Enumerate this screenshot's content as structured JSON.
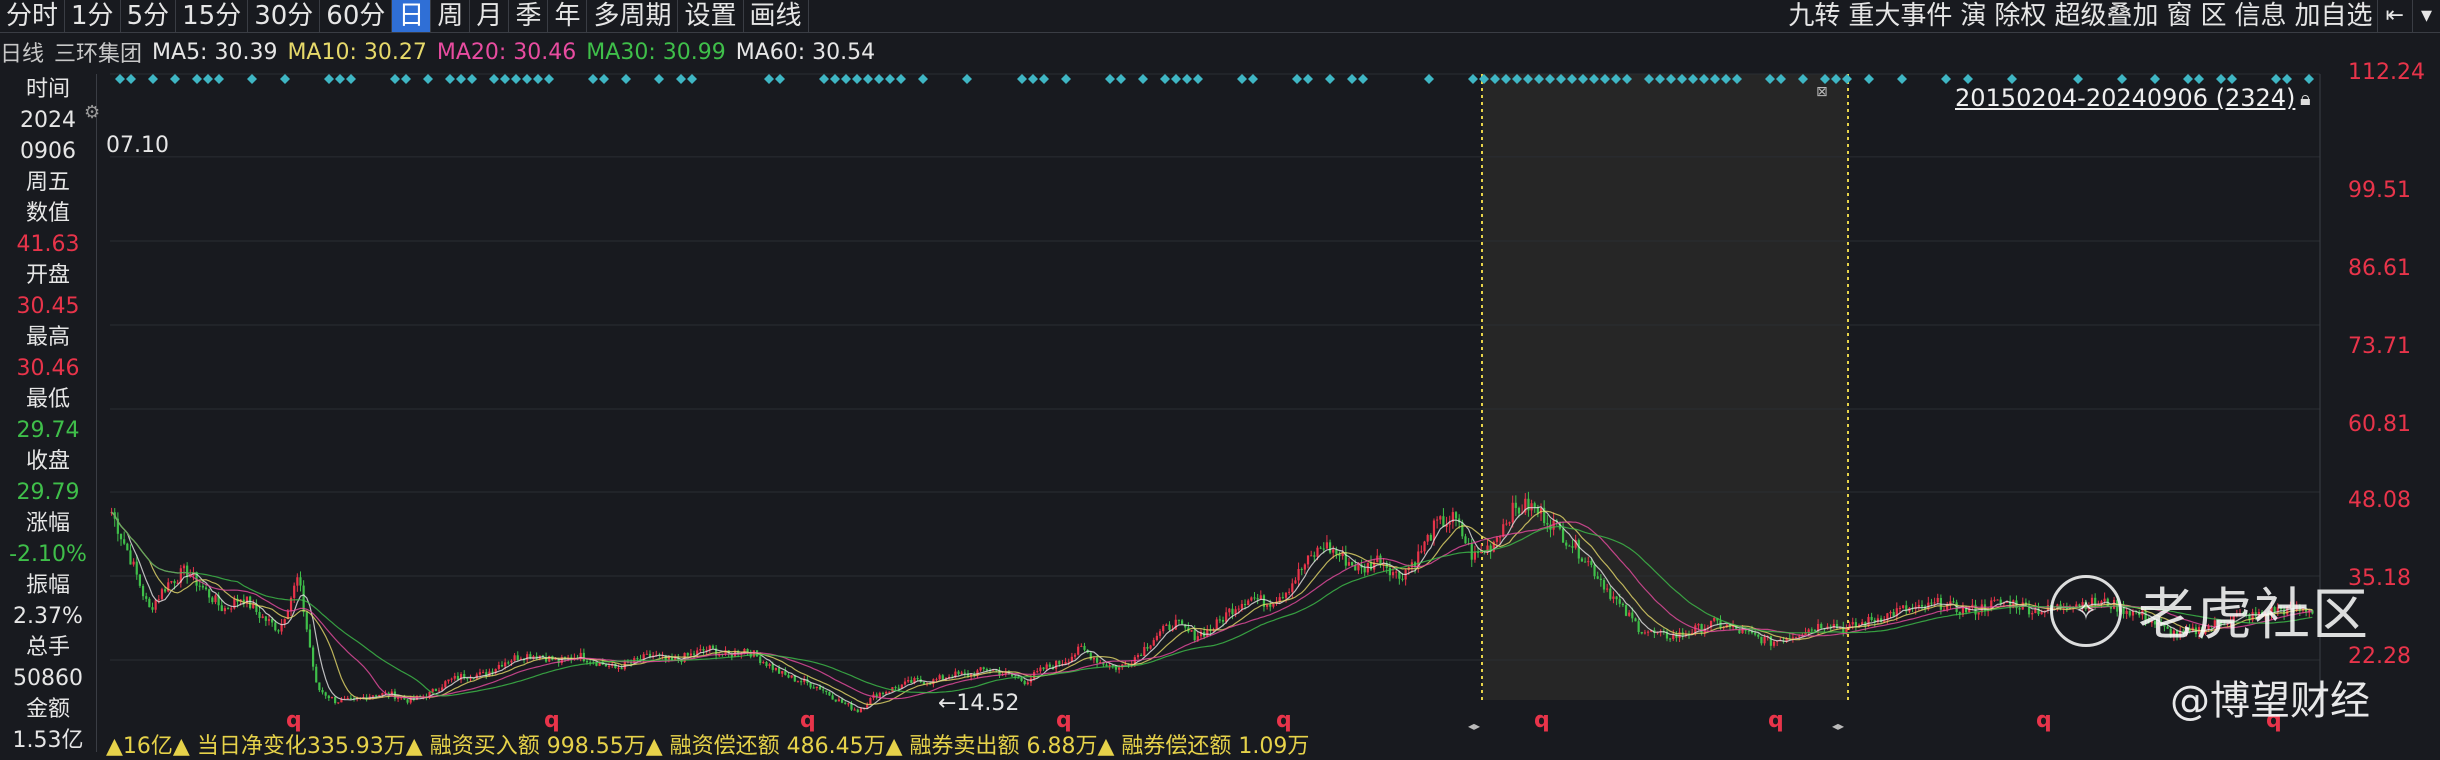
{
  "toolbar": {
    "periods": [
      "分时",
      "1分",
      "5分",
      "15分",
      "30分",
      "60分",
      "日",
      "周",
      "月",
      "季",
      "年",
      "多周期",
      "设置",
      "画线"
    ],
    "active_period": "日",
    "right_items": [
      "九转",
      "重大事件",
      "演",
      "除权",
      "超级叠加",
      "窗",
      "区",
      "信息",
      "加自选"
    ],
    "icons": [
      "jump-to-start-icon",
      "dropdown-arrow-icon"
    ]
  },
  "ma_bar": {
    "chart_type": "日线",
    "stock_name": "三环集团",
    "ma5": "MA5: 30.39",
    "ma10": "MA10: 30.27",
    "ma20": "MA20: 30.46",
    "ma30": "MA30: 30.99",
    "ma60": "MA60: 30.54",
    "colors": {
      "ma5": "#e6e6e6",
      "ma10": "#e6d96a",
      "ma20": "#e84ca0",
      "ma30": "#3fbf4a",
      "ma60": "#e6e6e6"
    }
  },
  "sidebar": [
    {
      "label": "时间",
      "value": "2024",
      "value2": "0906",
      "value3": "周五"
    },
    {
      "label": "数值",
      "value": "41.63",
      "color": "#e8344a"
    },
    {
      "label": "开盘",
      "value": "30.45",
      "color": "#e8344a"
    },
    {
      "label": "最高",
      "value": "30.46",
      "color": "#e8344a"
    },
    {
      "label": "最低",
      "value": "29.74",
      "color": "#3fbf4a"
    },
    {
      "label": "收盘",
      "value": "29.79",
      "color": "#3fbf4a"
    },
    {
      "label": "涨幅",
      "value": "-2.10%",
      "color": "#3fbf4a"
    },
    {
      "label": "振幅",
      "value": "2.37%",
      "color": "#e6e6e6"
    },
    {
      "label": "总手",
      "value": "50860",
      "color": "#e6e6e6"
    },
    {
      "label": "金额",
      "value": "1.53亿",
      "color": "#e6e6e6"
    }
  ],
  "chart": {
    "range_label": "20150204-20240906 (2324)",
    "price_axis": [
      "112.24",
      "99.51",
      "86.61",
      "73.71",
      "60.81",
      "48.08",
      "35.18",
      "22.28"
    ],
    "cursor_price_left": "07.10",
    "min_marker": "14.52",
    "q_marker": "q",
    "colors": {
      "up": "#e8344a",
      "down": "#3fbf4a",
      "diamond": "#3fb6c4",
      "highlight": "#262626",
      "vline": "#e6d24a"
    }
  },
  "chart_data": {
    "type": "candlestick",
    "x_range": [
      "20150204",
      "20240906"
    ],
    "bar_count": 2324,
    "ylim": [
      14.52,
      112.24
    ],
    "y_ticks": [
      112.24,
      99.51,
      86.61,
      73.71,
      60.81,
      48.08,
      35.18,
      22.28
    ],
    "close_trend": [
      45,
      38,
      30,
      34,
      36,
      33,
      30,
      32,
      29,
      27,
      35,
      18,
      16,
      16,
      17,
      17,
      16,
      17,
      19,
      20,
      20,
      22,
      23,
      23,
      22,
      23,
      22,
      21,
      22,
      23,
      22,
      23,
      24,
      23,
      24,
      22,
      20,
      19,
      18,
      16,
      14.52,
      17,
      18,
      19,
      19,
      20,
      20,
      21,
      20,
      19,
      21,
      22,
      24,
      22,
      21,
      23,
      26,
      28,
      26,
      27,
      30,
      32,
      31,
      33,
      37,
      40,
      38,
      36,
      38,
      35,
      38,
      43,
      44,
      38,
      40,
      45,
      46,
      44,
      41,
      38,
      34,
      30,
      27,
      26,
      26,
      27,
      28,
      27,
      26,
      25,
      26,
      27,
      28,
      27,
      28,
      29,
      30,
      30,
      31,
      30,
      30,
      31,
      31,
      30,
      30,
      31,
      31,
      31,
      30,
      29,
      27,
      26,
      27,
      28,
      29,
      29,
      30,
      30,
      30
    ]
  },
  "watermark": {
    "brand": "老虎社区",
    "sub": "@博望财经"
  },
  "bottom_text": "▲16亿▲ 当日净变化335.93万▲ 融资买入额 998.55万▲ 融资偿还额 486.45万▲ 融券卖出额 6.88万▲ 融券偿还额 1.09万"
}
